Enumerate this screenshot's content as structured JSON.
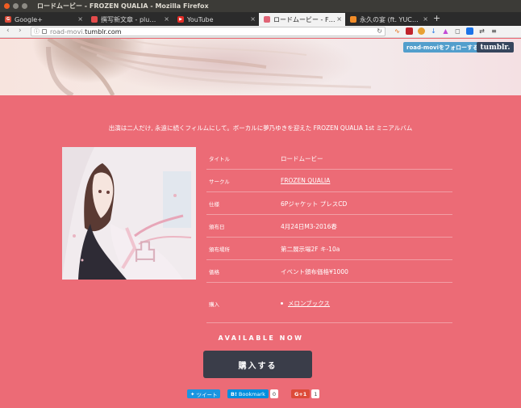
{
  "window": {
    "title": "ロードムービー - FROZEN QUALIA - Mozilla Firefox"
  },
  "tabs": [
    {
      "label": "Google+",
      "icon": "google-plus-icon",
      "color": "#dd4b39"
    },
    {
      "label": "撰写新文章 - plu…",
      "icon": "pluto-icon",
      "color": "#e44b4b"
    },
    {
      "label": "YouTube",
      "icon": "youtube-icon",
      "color": "#e52d27"
    },
    {
      "label": "ロードムービー - F…",
      "icon": "tumblr-favicon",
      "color": "#e06476",
      "active": true
    },
    {
      "label": "永久の宴 (ft. YUC…",
      "icon": "music-icon",
      "color": "#f28c28"
    }
  ],
  "address": {
    "prefix": "road-movi.",
    "domain": "tumblr.com"
  },
  "tumblr": {
    "follow_label": "road-moviをフォローする",
    "logo": "tumblr."
  },
  "content": {
    "intro": "出演は二人だけ, 永遠に続くフィルムにして。ボーカルに夢乃ゆきを迎えた FROZEN QUALIA 1st ミニアルバム",
    "details": [
      {
        "label": "タイトル",
        "value": "ロードムービー",
        "link": false
      },
      {
        "label": "サークル",
        "value": "FROZEN QUALIA",
        "link": true
      },
      {
        "label": "仕様",
        "value": "6Pジャケット プレスCD",
        "link": false
      },
      {
        "label": "頒布日",
        "value": "4月24日M3-2016春",
        "link": false
      },
      {
        "label": "頒布場所",
        "value": "第二展示場2F キ-10a",
        "link": false
      },
      {
        "label": "価格",
        "value": "イベント頒布価格¥1000",
        "link": false
      }
    ],
    "buy": {
      "label": "購入",
      "shop": "メロンブックス"
    },
    "available": "AVAILABLE NOW",
    "buy_button": "購入する"
  },
  "share": {
    "tweet": {
      "label": "ツイート",
      "color": "#1b95e0"
    },
    "hatena": {
      "label": "Bookmark",
      "count": "0",
      "color": "#008fde"
    },
    "gplus": {
      "label": "G+1",
      "count": "1",
      "color": "#dd4b39"
    }
  }
}
